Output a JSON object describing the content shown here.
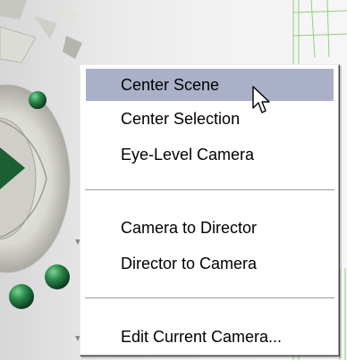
{
  "context_menu": {
    "items": [
      {
        "label": "Center Scene",
        "highlighted": true
      },
      {
        "label": "Center Selection"
      },
      {
        "label": "Eye-Level Camera"
      },
      {
        "label": "Camera to Director"
      },
      {
        "label": "Director to Camera"
      },
      {
        "label": "Edit Current Camera..."
      }
    ],
    "highlight_color": "#aab0c8"
  },
  "viewport": {
    "sphere_color": "#1f6b3a",
    "wireframe_color": "#8fd07f"
  },
  "cursor": {
    "icon": "arrow-pointer-icon"
  }
}
